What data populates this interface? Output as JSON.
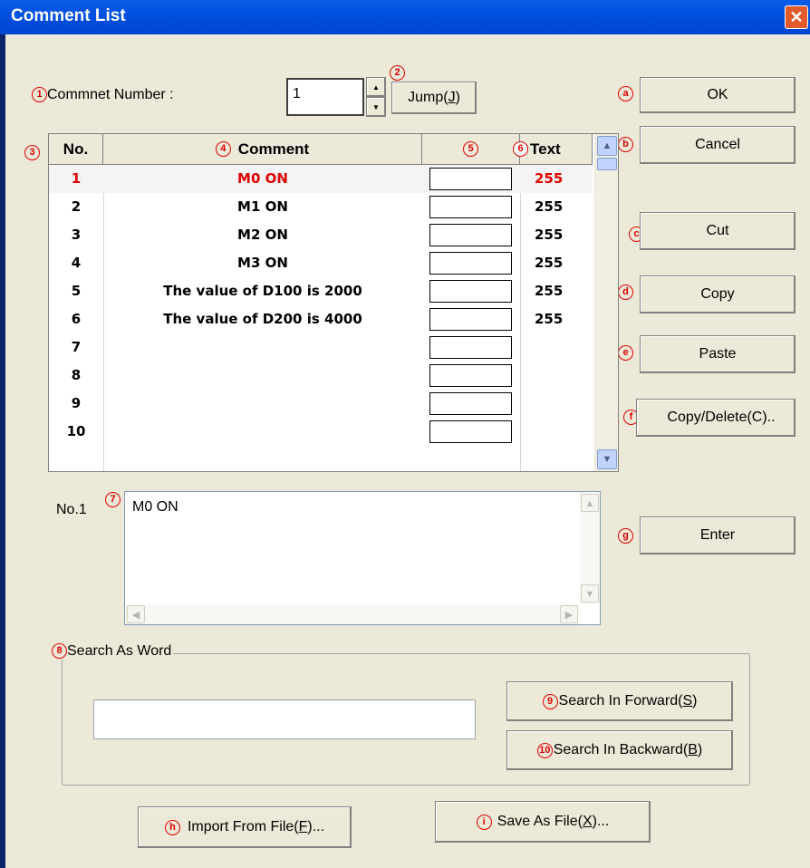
{
  "window": {
    "title": "Comment List",
    "close": "✕"
  },
  "markers": {
    "m1": "1",
    "m2": "2",
    "m3": "3",
    "m4": "4",
    "m5": "5",
    "m6": "6",
    "m7": "7",
    "m8": "8",
    "m9": "9",
    "m10": "10",
    "a": "a",
    "b": "b",
    "c": "c",
    "d": "d",
    "e": "e",
    "f": "f",
    "g": "g",
    "h": "h",
    "i": "i"
  },
  "number": {
    "label": "Commnet Number :",
    "value": "1",
    "up": "▲",
    "down": "▼",
    "jump": "Jump(",
    "jump_key": "J",
    "jump_end": ")"
  },
  "grid": {
    "headers": {
      "no": "No.",
      "comment": "Comment",
      "text": "Text"
    },
    "rows": [
      {
        "no": "1",
        "comment": "M0 ON",
        "text": "255"
      },
      {
        "no": "2",
        "comment": "M1 ON",
        "text": "255"
      },
      {
        "no": "3",
        "comment": "M2 ON",
        "text": "255"
      },
      {
        "no": "4",
        "comment": "M3 ON",
        "text": "255"
      },
      {
        "no": "5",
        "comment": "The value of D100 is 2000",
        "text": "255"
      },
      {
        "no": "6",
        "comment": "The value of D200 is 4000",
        "text": "255"
      },
      {
        "no": "7",
        "comment": "",
        "text": ""
      },
      {
        "no": "8",
        "comment": "",
        "text": ""
      },
      {
        "no": "9",
        "comment": "",
        "text": ""
      },
      {
        "no": "10",
        "comment": "",
        "text": ""
      }
    ]
  },
  "buttons": {
    "ok": "OK",
    "cancel": "Cancel",
    "cut": "Cut",
    "copy": "Copy",
    "paste": "Paste",
    "copy_delete": "Copy/Delete(C)..",
    "enter": "Enter",
    "search_forward": "Search In Forward(",
    "search_forward_key": "S",
    "search_backward": "Search In Backward(",
    "search_backward_key": "B",
    "import": "Import From File(",
    "import_key": "F",
    "import_end": ")...",
    "save": "Save As File(",
    "save_key": "X",
    "save_end": ")..."
  },
  "memo": {
    "label": "No.1",
    "value": "M0 ON"
  },
  "search": {
    "label": "Search As Word",
    "value": ""
  },
  "colors": {
    "accent_red": "#e00000",
    "title_blue": "#0054e3"
  }
}
